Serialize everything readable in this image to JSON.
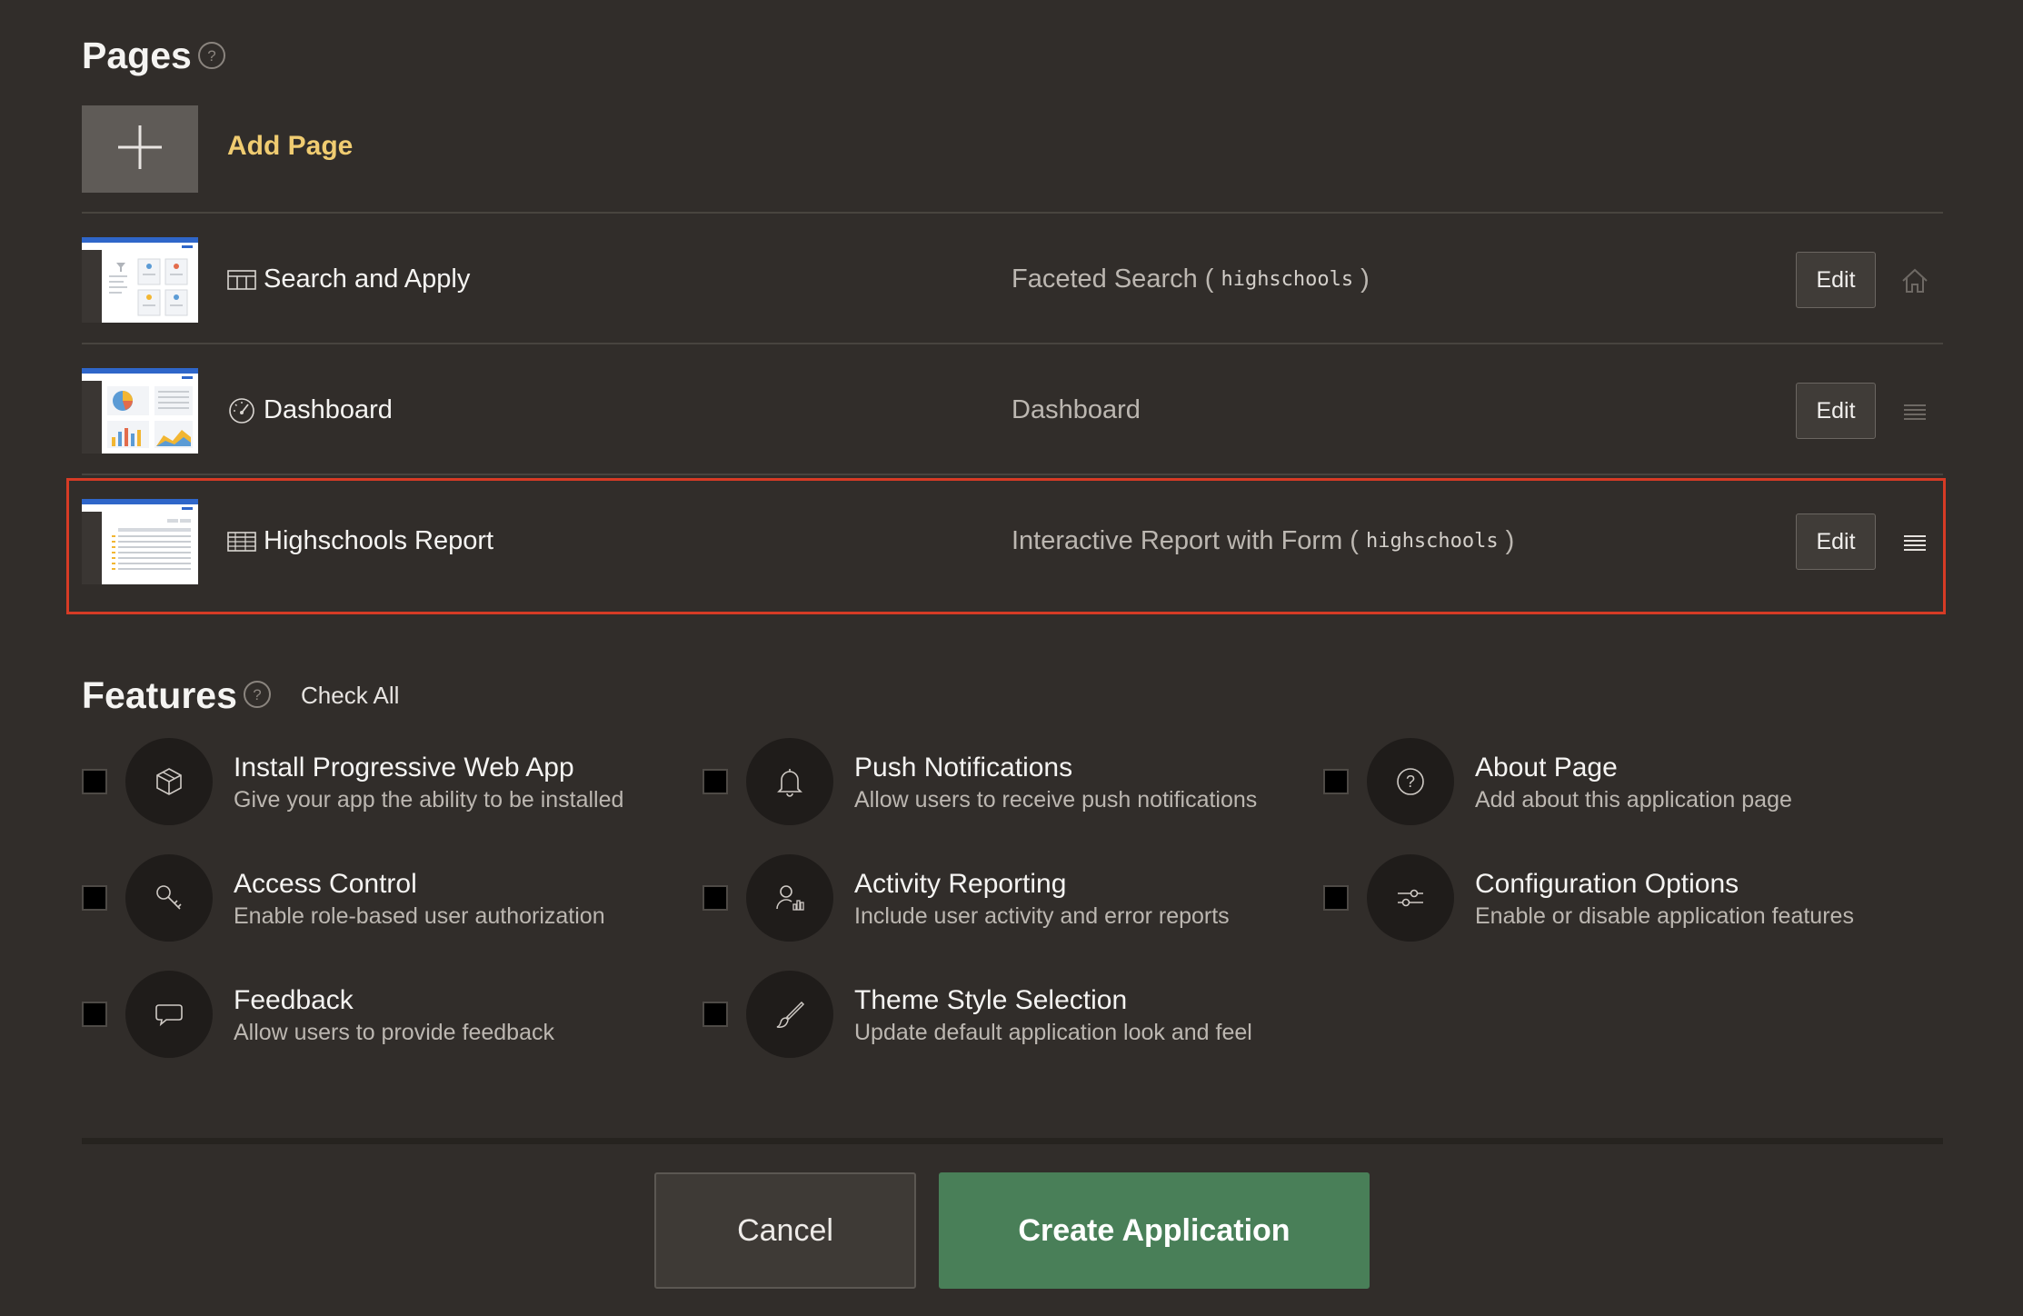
{
  "pages_section": {
    "title": "Pages",
    "help_icon": "help-circle-icon",
    "add_page_label": "Add Page",
    "rows": [
      {
        "name": "Search and Apply",
        "type": "Faceted Search (",
        "table": "highschools",
        "type_close": ")",
        "type_icon": "faceted-grid-icon",
        "edit_label": "Edit",
        "end_icon": "home-icon"
      },
      {
        "name": "Dashboard",
        "type": "Dashboard",
        "table": "",
        "type_close": "",
        "type_icon": "gauge-icon",
        "edit_label": "Edit",
        "end_icon": "drag-handle-icon"
      },
      {
        "name": "Highschools Report",
        "type": "Interactive Report with Form (",
        "table": "highschools",
        "type_close": ")",
        "type_icon": "report-table-icon",
        "edit_label": "Edit",
        "end_icon": "drag-handle-icon"
      }
    ]
  },
  "features_section": {
    "title": "Features",
    "check_all_label": "Check All",
    "items": [
      {
        "title": "Install Progressive Web App",
        "desc": "Give your app the ability to be installed",
        "icon": "box-icon",
        "checked": false
      },
      {
        "title": "Push Notifications",
        "desc": "Allow users to receive push notifications",
        "icon": "bell-icon",
        "checked": false
      },
      {
        "title": "About Page",
        "desc": "Add about this application page",
        "icon": "question-icon",
        "checked": false
      },
      {
        "title": "Access Control",
        "desc": "Enable role-based user authorization",
        "icon": "key-icon",
        "checked": false
      },
      {
        "title": "Activity Reporting",
        "desc": "Include user activity and error reports",
        "icon": "user-chart-icon",
        "checked": false
      },
      {
        "title": "Configuration Options",
        "desc": "Enable or disable application features",
        "icon": "sliders-icon",
        "checked": false
      },
      {
        "title": "Feedback",
        "desc": "Allow users to provide feedback",
        "icon": "speech-bubble-icon",
        "checked": false
      },
      {
        "title": "Theme Style Selection",
        "desc": "Update default application look and feel",
        "icon": "brush-icon",
        "checked": false
      }
    ]
  },
  "footer": {
    "cancel_label": "Cancel",
    "create_label": "Create Application"
  },
  "colors": {
    "background": "#312d2a",
    "accent_link": "#f0cc71",
    "create_button": "#497f58",
    "highlight_border": "#d63b25"
  }
}
